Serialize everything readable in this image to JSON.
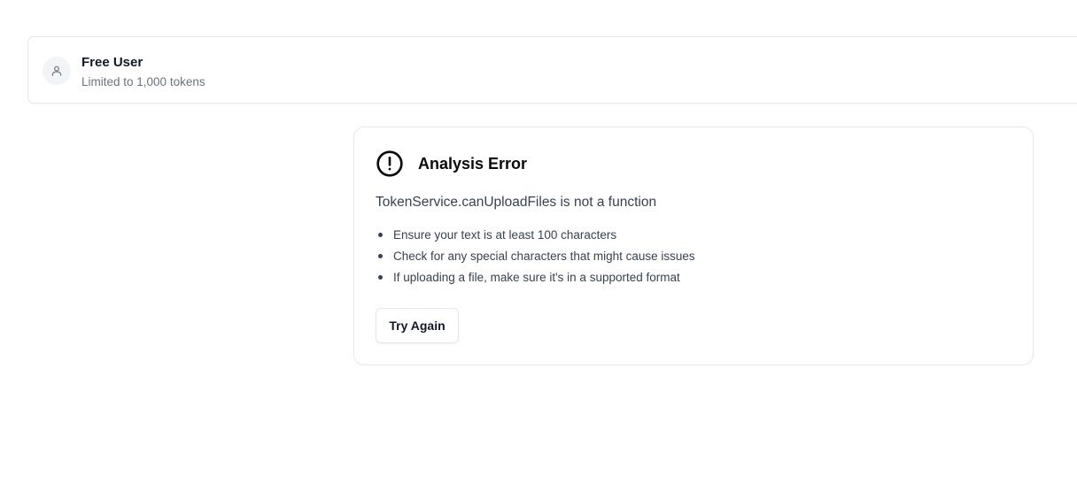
{
  "user": {
    "name": "Free User",
    "limit_text": "Limited to 1,000 tokens",
    "avatar_icon": "user-icon"
  },
  "error": {
    "icon": "alert-circle-icon",
    "title": "Analysis Error",
    "message": "TokenService.canUploadFiles is not a function",
    "tips": [
      "Ensure your text is at least 100 characters",
      "Check for any special characters that might cause issues",
      "If uploading a file, make sure it's in a supported format"
    ],
    "retry_label": "Try Again"
  },
  "colors": {
    "border": "#e5e7eb",
    "muted_text": "#6b7280",
    "body_text": "#374151",
    "heading": "#0a0a0a"
  }
}
